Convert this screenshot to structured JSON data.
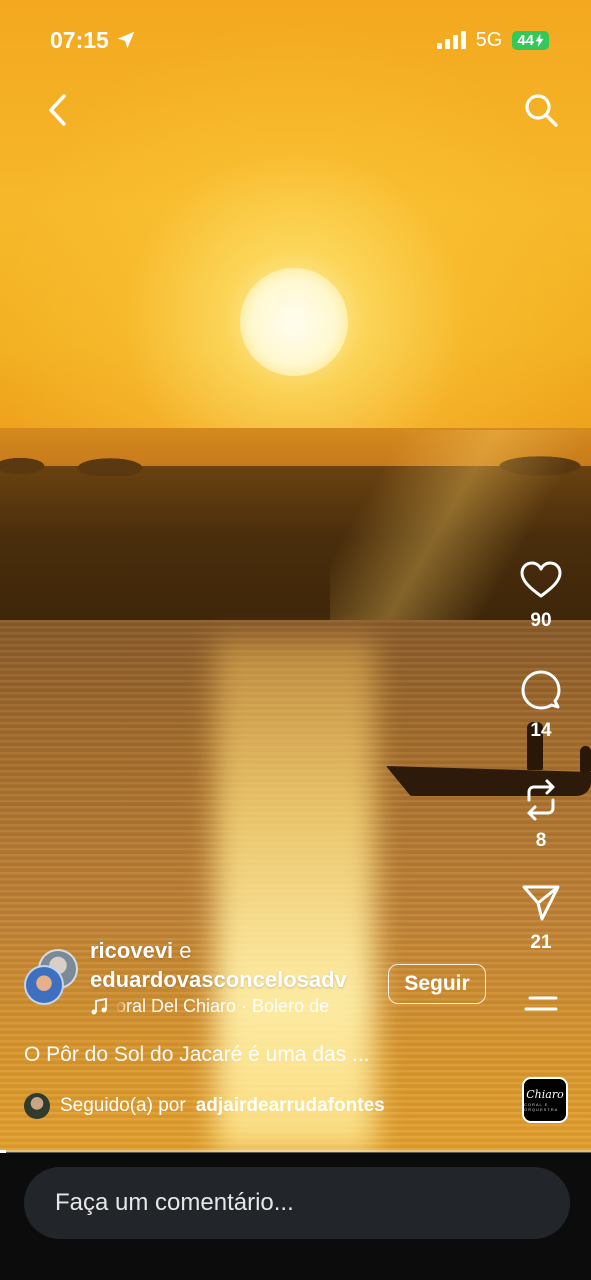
{
  "status_bar": {
    "time": "07:15",
    "network": "5G",
    "battery": "44"
  },
  "icons": {
    "back": "chevron-left-icon",
    "search": "search-icon",
    "like": "heart-icon",
    "comment": "comment-bubble-icon",
    "repost": "repost-icon",
    "share": "send-icon",
    "more": "menu-lines-icon"
  },
  "actions": {
    "likes": "90",
    "comments": "14",
    "reposts": "8",
    "shares": "21"
  },
  "post": {
    "author_1": "ricovevi",
    "connector": "e",
    "author_2": "eduardovasconcelosadv",
    "follow_label": "Seguir",
    "music": "oral Del Chiaro · Bolero de",
    "caption": "O Pôr do Sol do Jacaré é uma das ...",
    "followed_prefix": "Seguido(a) por",
    "followed_by": "adjairdearrudafontes"
  },
  "audio_thumb": {
    "line1": "Chiaro",
    "line2": "CORAL E ORQUESTRA"
  },
  "video": {
    "progress_percent": 1
  },
  "comment_input": {
    "placeholder": "Faça um comentário..."
  },
  "colors": {
    "accent_battery": "#34c759",
    "bottom_bar": "#0c0c0c",
    "comment_field": "#22262b"
  }
}
